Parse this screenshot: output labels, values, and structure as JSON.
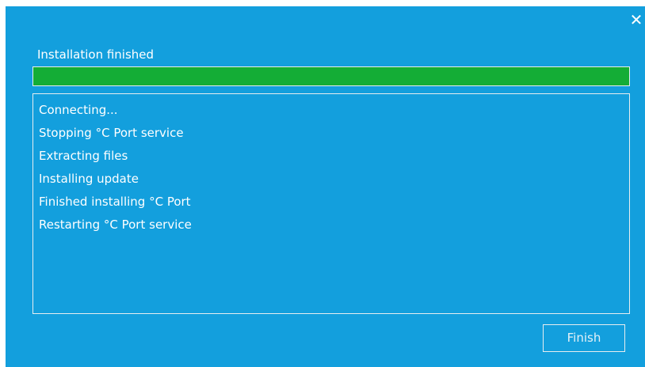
{
  "dialog": {
    "close_glyph": "✕",
    "status_label": "Installation finished",
    "progress": {
      "value_percent": 100,
      "fill_color": "#14ad36"
    },
    "log_lines": [
      "Connecting...",
      "Stopping °C Port service",
      "Extracting files",
      "Installing update",
      "Finished installing °C Port",
      "Restarting °C Port service"
    ],
    "finish_button": "Finish"
  },
  "colors": {
    "background": "#139fdd",
    "text": "#ffffff",
    "border": "#e8eef0",
    "progress": "#14ad36"
  }
}
